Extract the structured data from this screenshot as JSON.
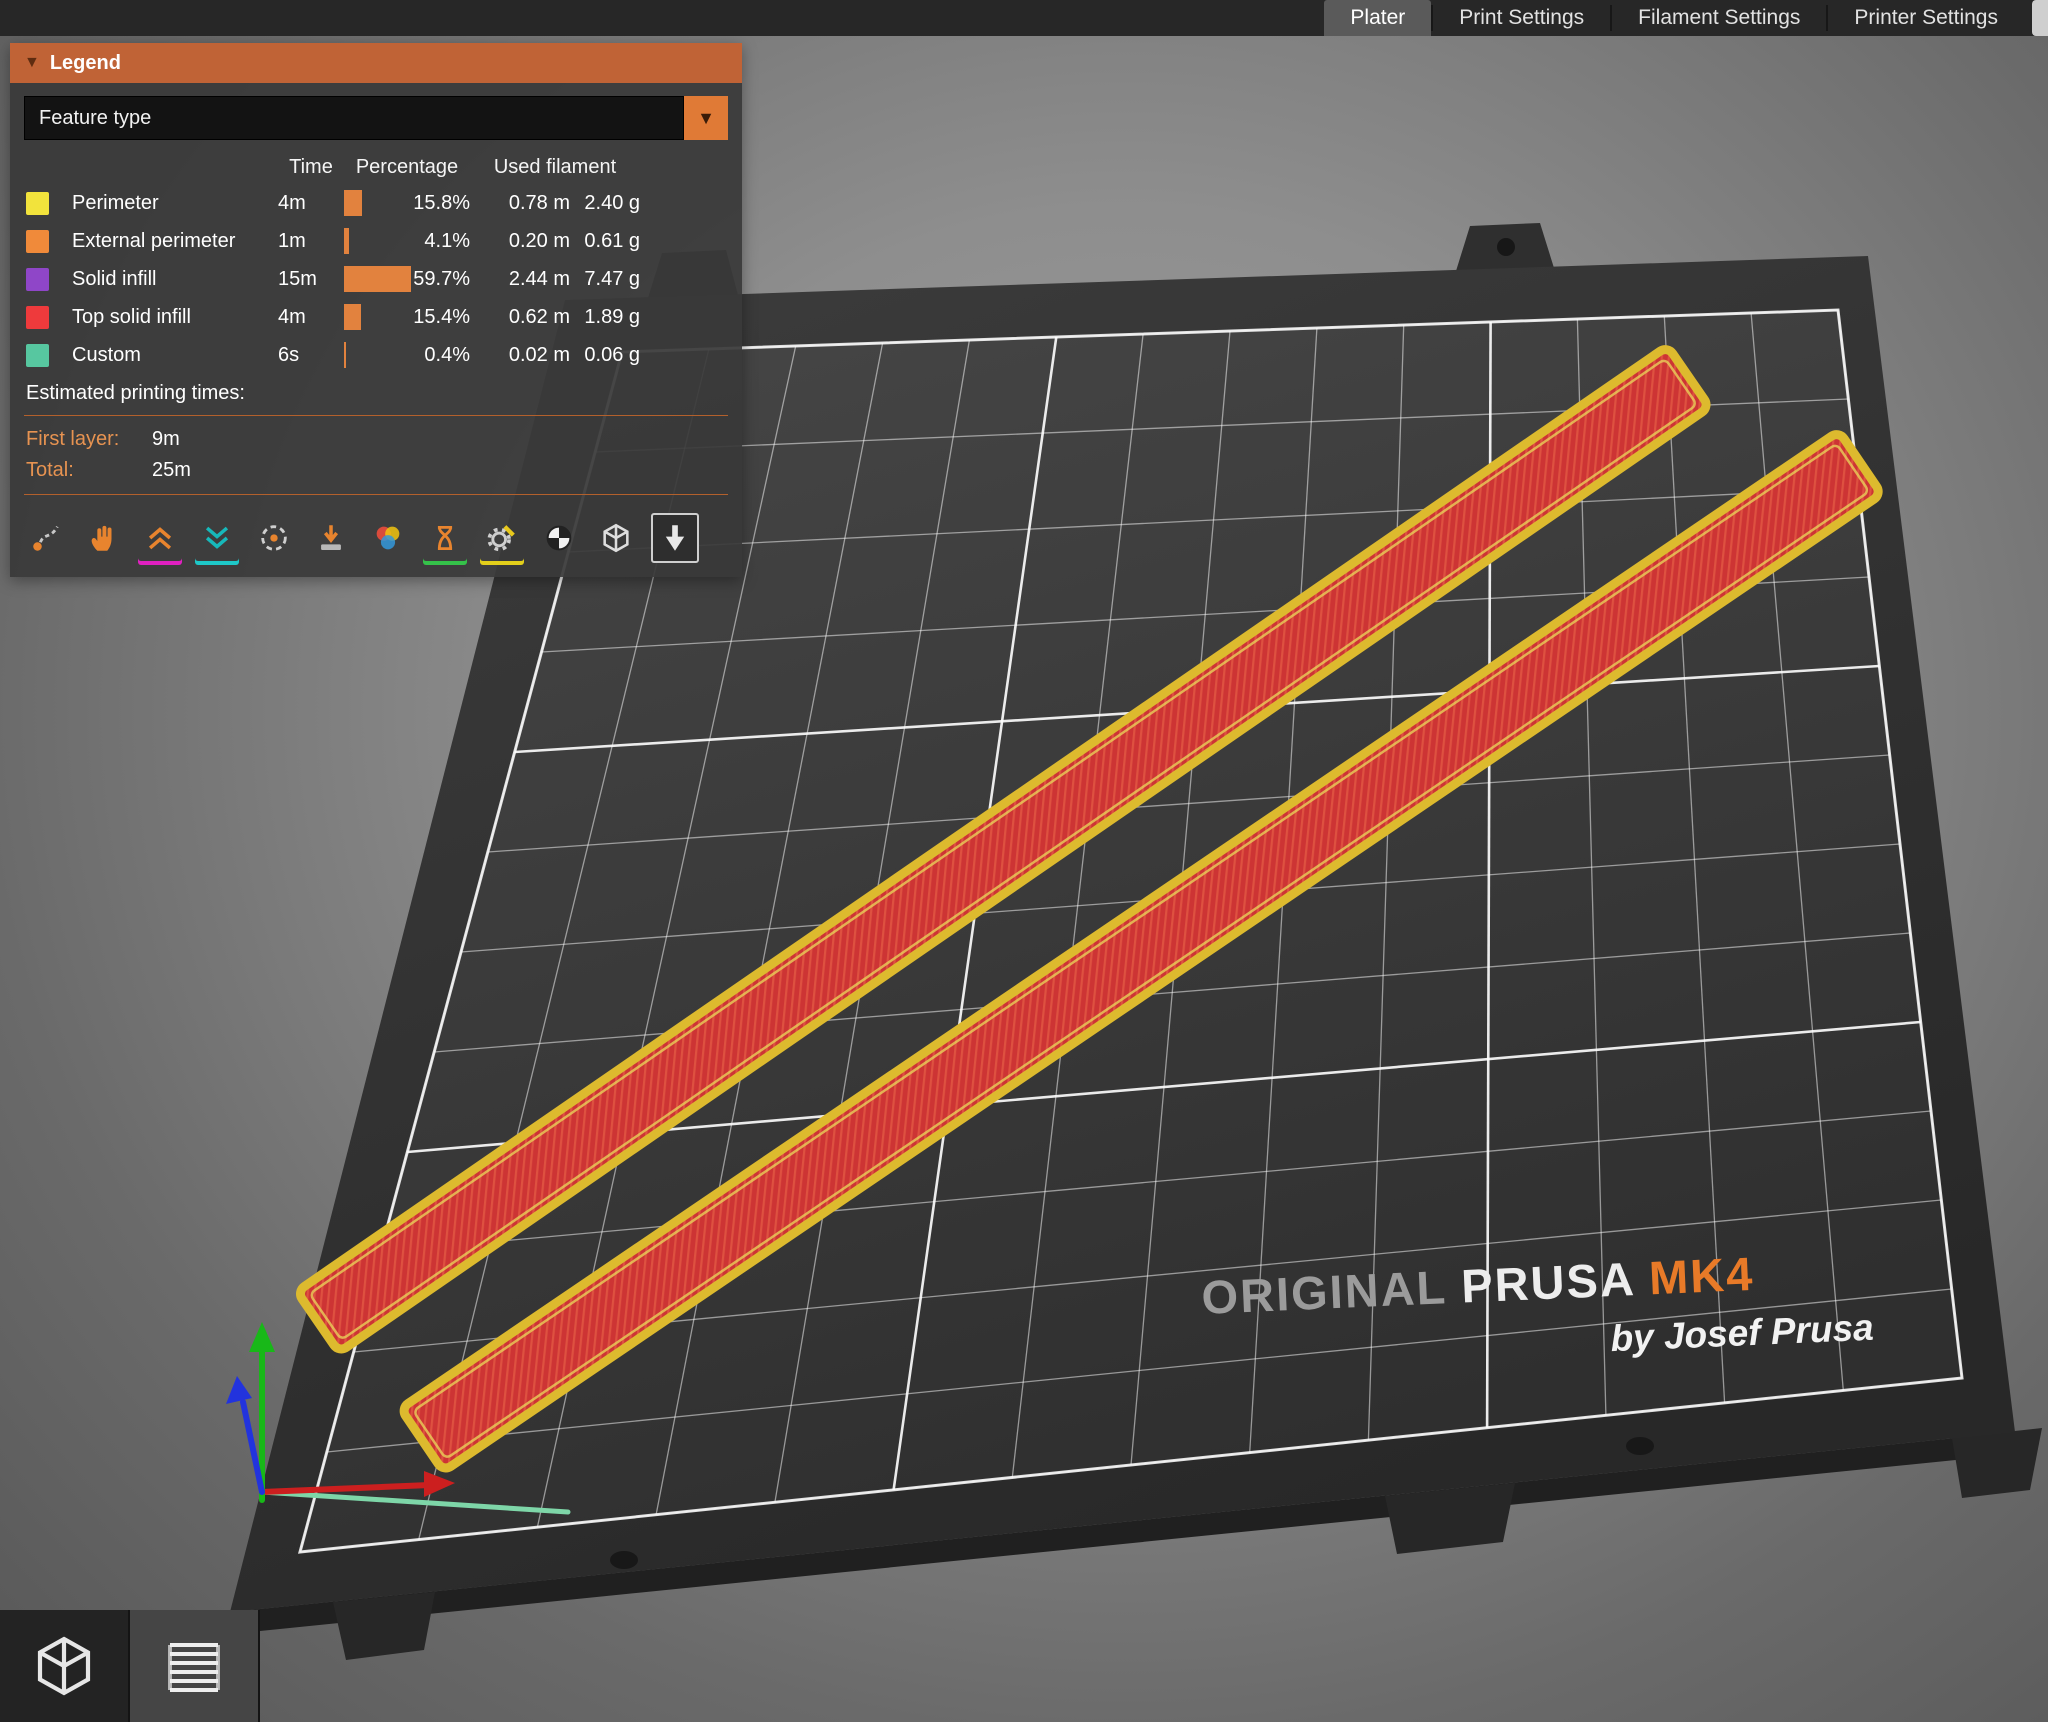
{
  "colors": {
    "accent_orange": "#e07a36",
    "legend_header": "#c06336",
    "bar_fill": "#e2823e",
    "bed_dark": "#2e2e2e",
    "grid_white": "#ffffff",
    "strip_fill": "#cd3434",
    "strip_border": "#ddba2e"
  },
  "top_bar": {
    "tabs": [
      {
        "label": "Plater",
        "selected": true
      },
      {
        "label": "Print Settings",
        "selected": false
      },
      {
        "label": "Filament Settings",
        "selected": false
      },
      {
        "label": "Printer Settings",
        "selected": false
      }
    ]
  },
  "legend": {
    "title": "Legend",
    "collapse_icon": "caret-down-icon",
    "view_select_value": "Feature type",
    "columns": {
      "time": "Time",
      "percentage": "Percentage",
      "used_filament": "Used filament"
    },
    "rows": [
      {
        "feature": "Perimeter",
        "color": "#f2e33c",
        "time": "4m",
        "percent": 15.8,
        "percent_label": "15.8%",
        "length": "0.78 m",
        "weight": "2.40 g"
      },
      {
        "feature": "External perimeter",
        "color": "#f08a3a",
        "time": "1m",
        "percent": 4.1,
        "percent_label": "4.1%",
        "length": "0.20 m",
        "weight": "0.61 g"
      },
      {
        "feature": "Solid infill",
        "color": "#8f46c8",
        "time": "15m",
        "percent": 59.7,
        "percent_label": "59.7%",
        "length": "2.44 m",
        "weight": "7.47 g"
      },
      {
        "feature": "Top solid infill",
        "color": "#ee3a3c",
        "time": "4m",
        "percent": 15.4,
        "percent_label": "15.4%",
        "length": "0.62 m",
        "weight": "1.89 g"
      },
      {
        "feature": "Custom",
        "color": "#57c7a0",
        "time": "6s",
        "percent": 0.4,
        "percent_label": "0.4%",
        "length": "0.02 m",
        "weight": "0.06 g"
      }
    ],
    "estimated_title": "Estimated printing times:",
    "first_layer_label": "First layer:",
    "first_layer_value": "9m",
    "total_label": "Total:",
    "total_value": "25m",
    "toolbar_icons": [
      {
        "name": "travels-icon"
      },
      {
        "name": "wipe-icon"
      },
      {
        "name": "retractions-icon",
        "underline": "#e020c0"
      },
      {
        "name": "deretractions-icon",
        "underline": "#1ec8c8"
      },
      {
        "name": "seams-icon"
      },
      {
        "name": "tool-changes-icon"
      },
      {
        "name": "color-changes-icon"
      },
      {
        "name": "pause-prints-icon",
        "underline": "#35c24a"
      },
      {
        "name": "custom-gcodes-icon",
        "underline": "#e3cf1b"
      },
      {
        "name": "center-of-gravity-icon"
      },
      {
        "name": "shells-icon"
      },
      {
        "name": "tool-marker-icon",
        "selected": true
      }
    ]
  },
  "viewport": {
    "bed_brand": {
      "original": "ORIGINAL",
      "prusa": " PRUSA ",
      "mk4": "MK4",
      "byline": "by Josef Prusa"
    }
  },
  "view_buttons": [
    {
      "name": "3d-view"
    },
    {
      "name": "layers-view",
      "selected": true
    }
  ]
}
